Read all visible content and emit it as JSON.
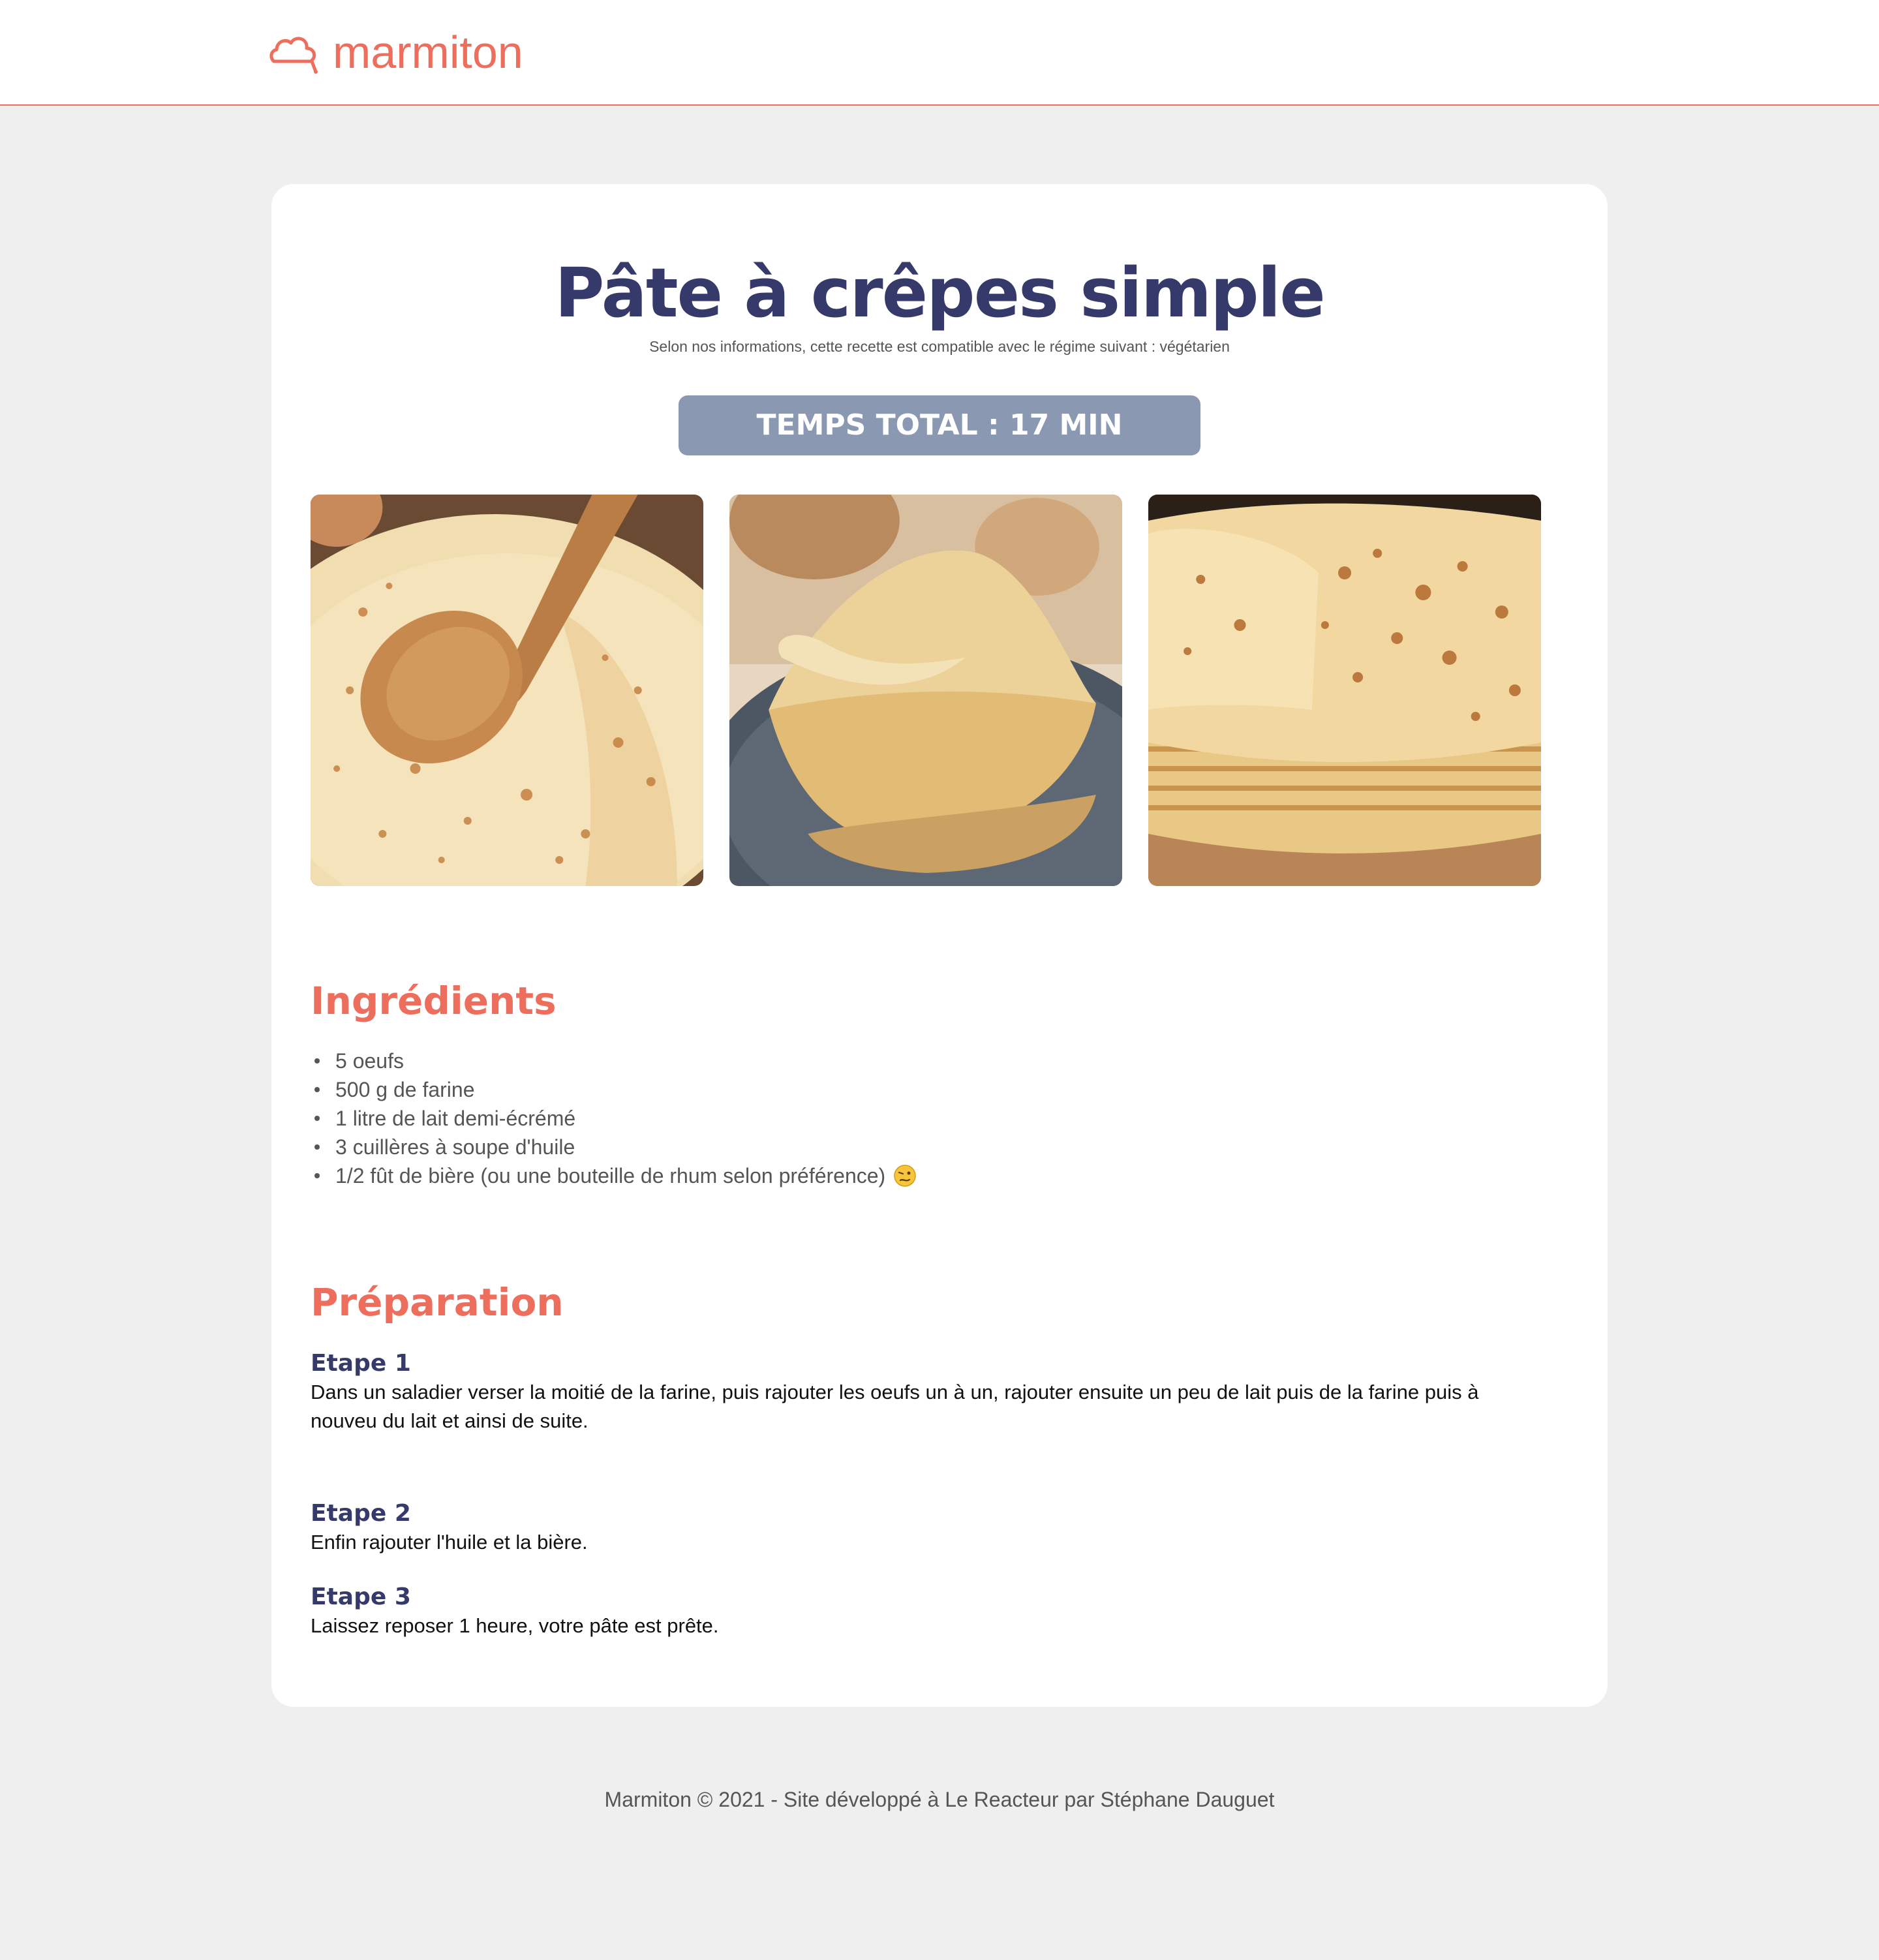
{
  "header": {
    "logo_text": "marmiton",
    "logo_icon": "chef-hat-icon",
    "accent_color": "#ee6e5e"
  },
  "recipe": {
    "title": "Pâte à crêpes simple",
    "diet_note": "Selon nos informations, cette recette est compatible avec le régime suivant : végétarien",
    "total_time": "TEMPS TOTAL : 17 MIN",
    "photos": [
      "crepes-with-wooden-spoon",
      "folded-crepes-on-plate",
      "stack-of-crepes"
    ]
  },
  "ingredients": {
    "title": "Ingrédients",
    "items": [
      "5 oeufs",
      "500 g de farine",
      "1 litre de lait demi-écrémé",
      "3 cuillères à soupe d'huile",
      "1/2 fût de bière (ou une bouteille de rhum selon préférence)"
    ],
    "last_item_emoji": "woozy-face-icon"
  },
  "preparation": {
    "title": "Préparation",
    "steps": [
      {
        "title": "Etape 1",
        "text": "Dans un saladier verser la moitié de la farine, puis rajouter les oeufs un à un, rajouter ensuite un peu de lait puis de la farine puis à nouveu du lait et ainsi de suite."
      },
      {
        "title": "Etape 2",
        "text": "Enfin rajouter l'huile et la bière."
      },
      {
        "title": "Etape 3",
        "text": "Laissez reposer 1 heure, votre pâte est prête."
      }
    ]
  },
  "footer": {
    "text": "Marmiton © 2021 - Site développé à Le Reacteur par Stéphane Dauguet"
  }
}
